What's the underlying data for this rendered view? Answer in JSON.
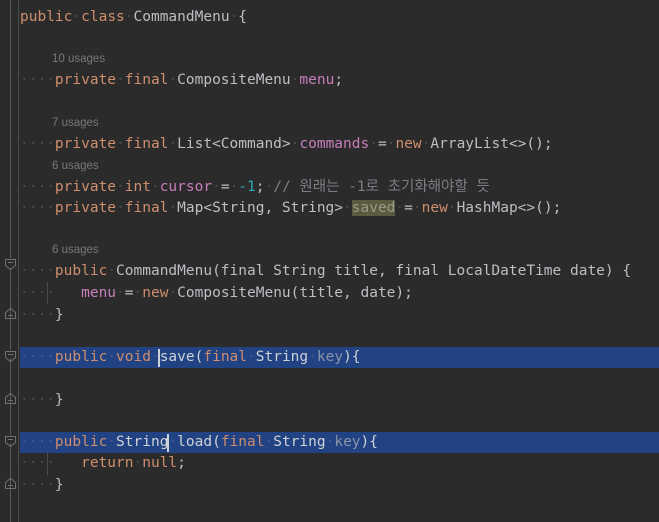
{
  "editor": {
    "language": "Java",
    "theme": "IntelliJ Darcula",
    "background": "#2b2b2b",
    "selection_color": "#214283",
    "caret_color": "#cdd2d8",
    "identifier_highlight_color": "#5b5b3f",
    "keyword_color": "#cf8e6d",
    "field_color": "#c77dbb",
    "number_color": "#2aacb8",
    "comment_color": "#7a7e85",
    "text_color": "#bcbec4",
    "hint_color": "#787878"
  },
  "hints": {
    "menu_usages": "10 usages",
    "commands_usages": "7 usages",
    "cursor_usages": "6 usages",
    "constructor_usages": "6 usages"
  },
  "code": {
    "class_decl": {
      "kw_public": "public",
      "kw_class": "class",
      "name": "CommandMenu",
      "brace": "{"
    },
    "field_menu": {
      "indent": "····",
      "kw_private": "private",
      "kw_final": "final",
      "type": "CompositeMenu",
      "name": "menu",
      "semi": ";"
    },
    "field_commands": {
      "indent": "····",
      "kw_private": "private",
      "kw_final": "final",
      "type": "List<Command>",
      "name": "commands",
      "eq": "=",
      "kw_new": "new",
      "init": "ArrayList<>();"
    },
    "field_cursor": {
      "indent": "····",
      "kw_private": "private",
      "kw_int": "int",
      "name": "cursor",
      "eq": "=",
      "value": "-1",
      "semi": ";",
      "comment": "// 원래는 -1로 초기화해야할 듯"
    },
    "field_saved": {
      "indent": "····",
      "kw_private": "private",
      "kw_final": "final",
      "type": "Map<String, String>",
      "name": "saved",
      "eq": "=",
      "kw_new": "new",
      "init": "HashMap<>();"
    },
    "constructor": {
      "indent": "····",
      "kw_public": "public",
      "name": "CommandMenu",
      "params": "(final String title, final LocalDateTime date) {",
      "body_indent": "····   ",
      "body": "menu = new CompositeMenu(title, date);",
      "body_menu": "menu",
      "body_eq": "=",
      "body_new": "new",
      "body_call": "CompositeMenu(title, date);",
      "close": "}"
    },
    "method_save": {
      "indent": "····",
      "kw_public": "public",
      "kw_void": "void",
      "name": "save",
      "params_open": "(",
      "kw_final": "final",
      "param_type": "String",
      "param_name": "key",
      "params_close": "){",
      "close": "}",
      "caret_after": "sa"
    },
    "method_load": {
      "indent": "····",
      "kw_public": "public",
      "return_type": "String",
      "name": "load",
      "params_open": "(",
      "kw_final": "final",
      "param_type": "String",
      "param_name": "key",
      "params_close": "){",
      "body_indent": "····   ",
      "kw_return": "return",
      "return_value": "null",
      "semi": ";",
      "close": "}",
      "caret_after": "l"
    }
  },
  "gutter": {
    "fold_open_icon": "fold-collapse-icon",
    "fold_close_icon": "fold-expand-end-icon"
  }
}
